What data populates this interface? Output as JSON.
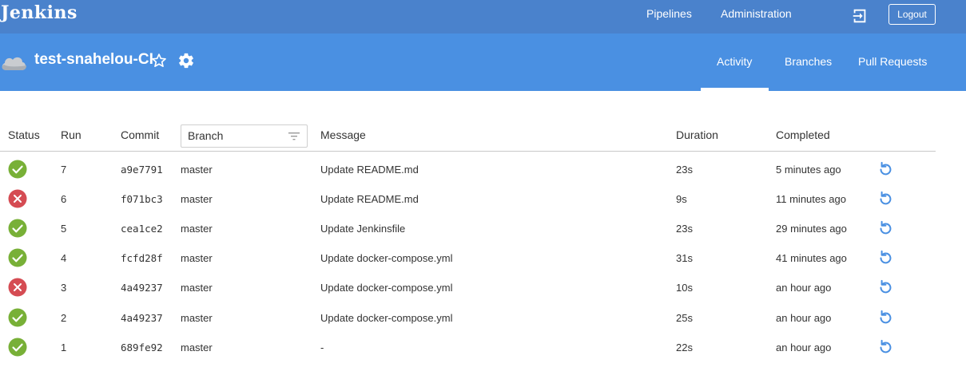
{
  "app": {
    "logo": "Jenkins"
  },
  "topnav": {
    "pipelines": "Pipelines",
    "administration": "Administration",
    "logout": "Logout"
  },
  "pipeline": {
    "name": "test-snahelou-CI"
  },
  "tabs": [
    {
      "label": "Activity",
      "active": true
    },
    {
      "label": "Branches"
    },
    {
      "label": "Pull Requests"
    }
  ],
  "table": {
    "headers": {
      "status": "Status",
      "run": "Run",
      "commit": "Commit",
      "branch": "Branch",
      "message": "Message",
      "duration": "Duration",
      "completed": "Completed"
    },
    "rows": [
      {
        "status": "success",
        "run": "7",
        "commit": "a9e7791",
        "branch": "master",
        "message": "Update README.md",
        "duration": "23s",
        "completed": "5 minutes ago"
      },
      {
        "status": "failure",
        "run": "6",
        "commit": "f071bc3",
        "branch": "master",
        "message": "Update README.md",
        "duration": "9s",
        "completed": "11 minutes ago"
      },
      {
        "status": "success",
        "run": "5",
        "commit": "cea1ce2",
        "branch": "master",
        "message": "Update Jenkinsfile",
        "duration": "23s",
        "completed": "29 minutes ago"
      },
      {
        "status": "success",
        "run": "4",
        "commit": "fcfd28f",
        "branch": "master",
        "message": "Update docker-compose.yml",
        "duration": "31s",
        "completed": "41 minutes ago"
      },
      {
        "status": "failure",
        "run": "3",
        "commit": "4a49237",
        "branch": "master",
        "message": "Update docker-compose.yml",
        "duration": "10s",
        "completed": "an hour ago"
      },
      {
        "status": "success",
        "run": "2",
        "commit": "4a49237",
        "branch": "master",
        "message": "Update docker-compose.yml",
        "duration": "25s",
        "completed": "an hour ago"
      },
      {
        "status": "success",
        "run": "1",
        "commit": "689fe92",
        "branch": "master",
        "message": "-",
        "duration": "22s",
        "completed": "an hour ago"
      }
    ]
  },
  "colors": {
    "topbar": "#4a82cc",
    "header": "#4a90e2",
    "success": "#78b037",
    "failure": "#d54c53",
    "replay": "#4a90e2"
  },
  "icons": {
    "status_success": "check-circle-icon",
    "status_failure": "x-circle-icon",
    "replay": "replay-icon",
    "favorite": "star-icon",
    "settings": "gear-icon",
    "logout": "exit-icon",
    "filter": "filter-icon",
    "pipeline": "cloud-icon"
  }
}
